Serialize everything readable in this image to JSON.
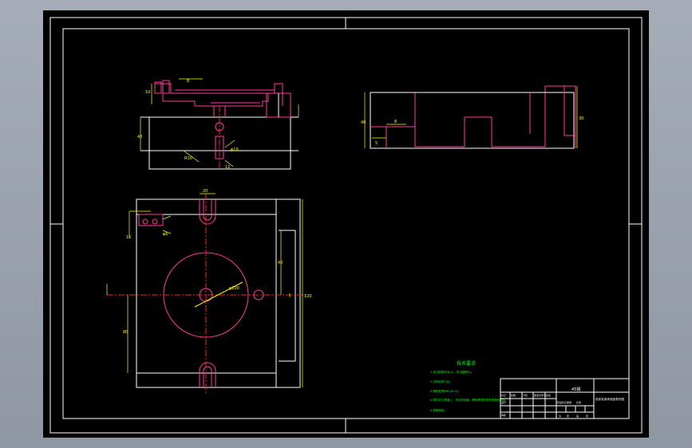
{
  "drawing": {
    "tech_requirements": {
      "title": "技术要求",
      "lines": [
        "1.未注倒角均为C1，未注圆角R1。",
        "2.去除毛刺飞边。",
        "3.调质处理HRC28-32。",
        "4.零件加工表面上，不应有划痕、擦伤等损伤零件表面的缺陷。",
        "5.锐角倒钝。"
      ]
    },
    "title_block": {
      "material": "45钢",
      "part_name": "铣床夹具体底板零件图",
      "sign_row": [
        "标记",
        "处数",
        "分区",
        "更改文件号",
        "签名",
        "年月日"
      ],
      "scale_row": [
        "阶段标记",
        "重量",
        "比例"
      ],
      "sheet_row": [
        "共",
        "张",
        "第",
        "张"
      ],
      "design_label": "设计",
      "check_label": "审核"
    }
  },
  "colors": {
    "outline": "#ffffff",
    "dimension": "#ffff00",
    "hidden": "#ff3d9a",
    "centerline": "#ff2020",
    "note": "#00ff00"
  }
}
